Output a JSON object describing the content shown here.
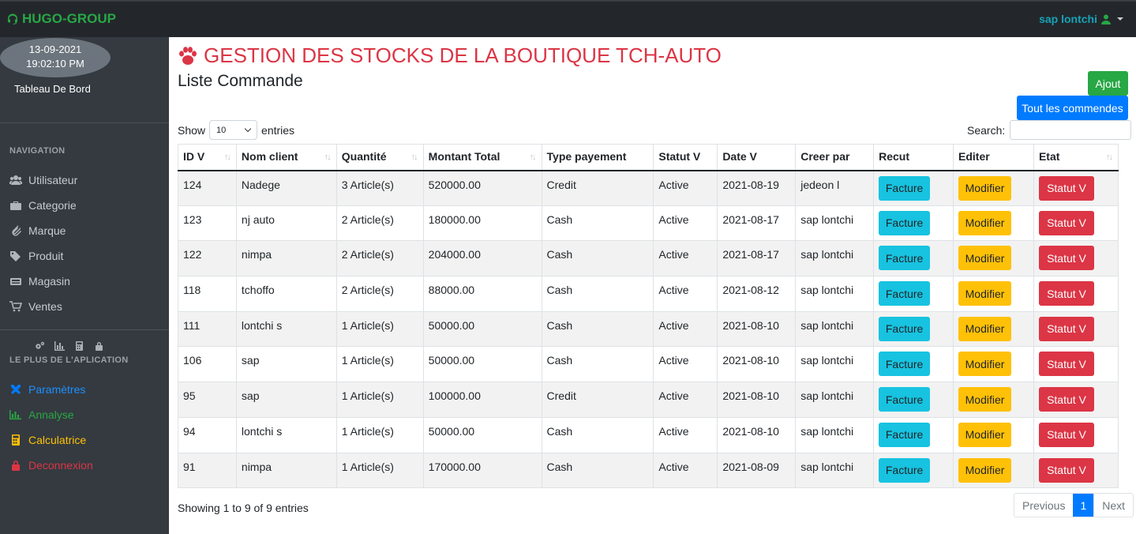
{
  "header": {
    "brand": "HUGO-GROUP",
    "user": "sap lontchi"
  },
  "sidebar": {
    "date": "13-09-2021",
    "time": "19:02:10 PM",
    "dashboard": "Tableau De Bord",
    "nav_title": "NAVIGATION",
    "items": [
      {
        "label": "Utilisateur",
        "icon": "users-icon"
      },
      {
        "label": "Categorie",
        "icon": "briefcase-icon"
      },
      {
        "label": "Marque",
        "icon": "paperclip-icon"
      },
      {
        "label": "Produit",
        "icon": "tags-icon"
      },
      {
        "label": "Magasin",
        "icon": "store-icon"
      },
      {
        "label": "Ventes",
        "icon": "cart-icon"
      }
    ],
    "plus_title": "LE PLUS DE L'APLICATION",
    "extras": [
      {
        "label": "Paramètres",
        "color": "#007bff"
      },
      {
        "label": "Annalyse",
        "color": "#28a745"
      },
      {
        "label": "Calculatrice",
        "color": "#ffc107"
      },
      {
        "label": "Deconnexion",
        "color": "#dc3545"
      }
    ]
  },
  "main": {
    "title": "GESTION DES STOCKS DE LA BOUTIQUE TCH-AUTO",
    "subtitle": "Liste Commande",
    "btn_ajout": "Ajout",
    "btn_all": "Tout les commendes",
    "show_label": "Show",
    "show_value": "10",
    "entries_label": "entries",
    "search_label": "Search:",
    "columns": [
      "ID V",
      "Nom client",
      "Quantité",
      "Montant Total",
      "Type payement",
      "Statut V",
      "Date V",
      "Creer par",
      "Recut",
      "Editer",
      "Etat"
    ],
    "rows": [
      [
        "124",
        "Nadege",
        "3 Article(s)",
        "520000.00",
        "Credit",
        "Active",
        "2021-08-19",
        "jedeon l"
      ],
      [
        "123",
        "nj auto",
        "2 Article(s)",
        "180000.00",
        "Cash",
        "Active",
        "2021-08-17",
        "sap lontchi"
      ],
      [
        "122",
        "nimpa",
        "2 Article(s)",
        "204000.00",
        "Cash",
        "Active",
        "2021-08-17",
        "sap lontchi"
      ],
      [
        "118",
        "tchoffo",
        "2 Article(s)",
        "88000.00",
        "Cash",
        "Active",
        "2021-08-12",
        "sap lontchi"
      ],
      [
        "111",
        "lontchi s",
        "1 Article(s)",
        "50000.00",
        "Cash",
        "Active",
        "2021-08-10",
        "sap lontchi"
      ],
      [
        "106",
        "sap",
        "1 Article(s)",
        "50000.00",
        "Cash",
        "Active",
        "2021-08-10",
        "sap lontchi"
      ],
      [
        "95",
        "sap",
        "1 Article(s)",
        "100000.00",
        "Credit",
        "Active",
        "2021-08-10",
        "sap lontchi"
      ],
      [
        "94",
        "lontchi s",
        "1 Article(s)",
        "50000.00",
        "Cash",
        "Active",
        "2021-08-10",
        "sap lontchi"
      ],
      [
        "91",
        "nimpa",
        "1 Article(s)",
        "170000.00",
        "Cash",
        "Active",
        "2021-08-09",
        "sap lontchi"
      ]
    ],
    "btn_facture": "Facture",
    "btn_modifier": "Modifier",
    "btn_statut": "Statut V",
    "info": "Showing 1 to 9 of 9 entries",
    "pager": {
      "prev": "Previous",
      "page": "1",
      "next": "Next"
    }
  }
}
